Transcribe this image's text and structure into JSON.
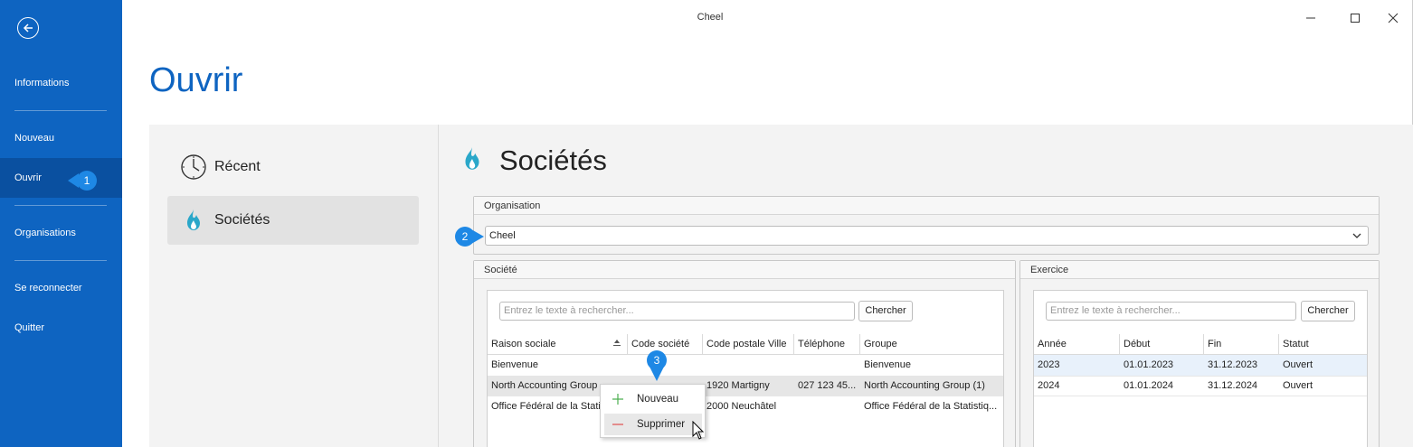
{
  "window": {
    "title": "Cheel"
  },
  "sidebar": {
    "items": [
      {
        "label": "Informations"
      },
      {
        "label": "Nouveau"
      },
      {
        "label": "Ouvrir"
      },
      {
        "label": "Organisations"
      },
      {
        "label": "Se reconnecter"
      },
      {
        "label": "Quitter"
      }
    ]
  },
  "page": {
    "title": "Ouvrir"
  },
  "leftnav": {
    "items": [
      {
        "label": "Récent",
        "icon": "clock-icon"
      },
      {
        "label": "Sociétés",
        "icon": "flame-icon"
      }
    ]
  },
  "panel": {
    "heading": "Sociétés",
    "organisation": {
      "title": "Organisation",
      "value": "Cheel"
    },
    "societe": {
      "title": "Société",
      "search_placeholder": "Entrez le texte à rechercher...",
      "search_button": "Chercher",
      "columns": [
        "Raison sociale",
        "Code société",
        "Code postale Ville",
        "Téléphone",
        "Groupe"
      ],
      "rows": [
        [
          "Bienvenue",
          "",
          "",
          "",
          "Bienvenue"
        ],
        [
          "North Accounting Group",
          "",
          "1920 Martigny",
          "027 123 45...",
          "North Accounting Group (1)"
        ],
        [
          "Office Fédéral de la Statis",
          "",
          "2000 Neuchâtel",
          "",
          "Office Fédéral de la Statistiq..."
        ]
      ]
    },
    "exercice": {
      "title": "Exercice",
      "search_placeholder": "Entrez le texte à rechercher...",
      "search_button": "Chercher",
      "columns": [
        "Année",
        "Début",
        "Fin",
        "Statut"
      ],
      "rows": [
        [
          "2023",
          "01.01.2023",
          "31.12.2023",
          "Ouvert"
        ],
        [
          "2024",
          "01.01.2024",
          "31.12.2024",
          "Ouvert"
        ]
      ]
    }
  },
  "context_menu": {
    "items": [
      {
        "label": "Nouveau",
        "icon": "plus-icon"
      },
      {
        "label": "Supprimer",
        "icon": "minus-icon"
      }
    ]
  },
  "callouts": [
    "1",
    "2",
    "3"
  ],
  "colors": {
    "accent": "#0e64c1",
    "callout": "#1e88e5",
    "flame": "#2aa7c9"
  }
}
